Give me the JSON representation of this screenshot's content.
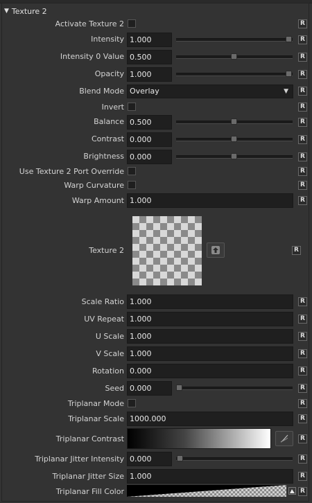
{
  "section": {
    "title": "Texture 2"
  },
  "reset_label": "R",
  "params": {
    "activate": {
      "label": "Activate Texture 2"
    },
    "intensity": {
      "label": "Intensity",
      "value": "1.000",
      "level": 1.0
    },
    "intensity0": {
      "label": "Intensity 0 Value",
      "value": "0.500",
      "level": 0.5
    },
    "opacity": {
      "label": "Opacity",
      "value": "1.000",
      "level": 1.0
    },
    "blend_mode": {
      "label": "Blend Mode",
      "value": "Overlay"
    },
    "invert": {
      "label": "Invert"
    },
    "balance": {
      "label": "Balance",
      "value": "0.500",
      "level": 0.5
    },
    "contrast": {
      "label": "Contrast",
      "value": "0.000",
      "level": 0.5
    },
    "brightness": {
      "label": "Brightness",
      "value": "0.000",
      "level": 0.5
    },
    "port_override": {
      "label": "Use Texture 2 Port Override"
    },
    "warp_curvature": {
      "label": "Warp Curvature"
    },
    "warp_amount": {
      "label": "Warp Amount",
      "value": "1.000"
    },
    "texture": {
      "label": "Texture 2"
    },
    "scale_ratio": {
      "label": "Scale Ratio",
      "value": "1.000"
    },
    "uv_repeat": {
      "label": "UV Repeat",
      "value": "1.000"
    },
    "u_scale": {
      "label": "U Scale",
      "value": "1.000"
    },
    "v_scale": {
      "label": "V Scale",
      "value": "1.000"
    },
    "rotation": {
      "label": "Rotation",
      "value": "0.000"
    },
    "seed": {
      "label": "Seed",
      "value": "0.000",
      "level": 0.0
    },
    "triplanar_mode": {
      "label": "Triplanar Mode"
    },
    "triplanar_scale": {
      "label": "Triplanar Scale",
      "value": "1000.000"
    },
    "triplanar_contrast": {
      "label": "Triplanar Contrast"
    },
    "triplanar_jitter_intensity": {
      "label": "Triplanar Jitter Intensity",
      "value": "0.000",
      "level": 0.0
    },
    "triplanar_jitter_size": {
      "label": "Triplanar Jitter Size",
      "value": "1.000"
    },
    "triplanar_fill_color": {
      "label": "Triplanar Fill Color"
    }
  }
}
